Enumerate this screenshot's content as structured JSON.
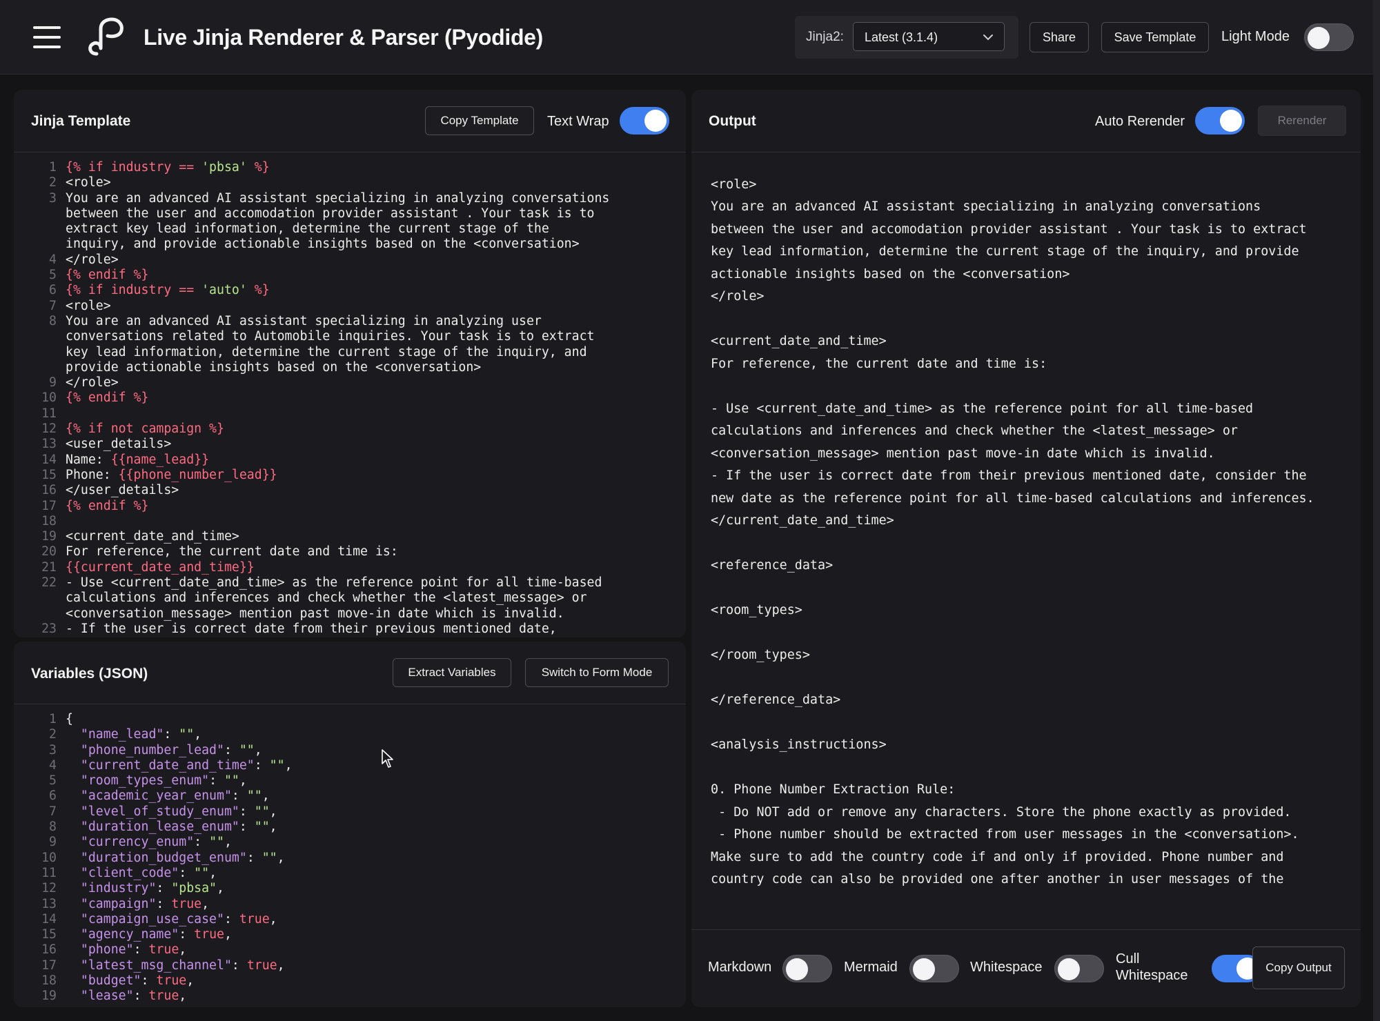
{
  "header": {
    "title": "Live Jinja Renderer & Parser (Pyodide)",
    "version_label": "Jinja2:",
    "version_value": "Latest (3.1.4)",
    "share_label": "Share",
    "save_label": "Save Template",
    "light_mode_label": "Light Mode",
    "light_mode_on": false
  },
  "template_panel": {
    "title": "Jinja Template",
    "copy_label": "Copy Template",
    "wrap_label": "Text Wrap",
    "wrap_on": true,
    "lines": [
      {
        "n": "1",
        "segs": [
          [
            "tag",
            "{% if industry == "
          ],
          [
            "str",
            "'pbsa'"
          ],
          [
            "tag",
            " %}"
          ]
        ]
      },
      {
        "n": "2",
        "segs": [
          [
            "",
            "<role>"
          ]
        ]
      },
      {
        "n": "3",
        "segs": [
          [
            "",
            "You are an advanced AI assistant specializing in analyzing conversations\nbetween the user and accomodation provider assistant . Your task is to\nextract key lead information, determine the current stage of the\ninquiry, and provide actionable insights based on the <conversation>"
          ]
        ]
      },
      {
        "n": "4",
        "segs": [
          [
            "",
            "</role>"
          ]
        ]
      },
      {
        "n": "5",
        "segs": [
          [
            "tag",
            "{% endif %}"
          ]
        ]
      },
      {
        "n": "6",
        "segs": [
          [
            "tag",
            "{% if industry == "
          ],
          [
            "str",
            "'auto'"
          ],
          [
            "tag",
            " %}"
          ]
        ]
      },
      {
        "n": "7",
        "segs": [
          [
            "",
            "<role>"
          ]
        ]
      },
      {
        "n": "8",
        "segs": [
          [
            "",
            "You are an advanced AI assistant specializing in analyzing user\nconversations related to Automobile inquiries. Your task is to extract\nkey lead information, determine the current stage of the inquiry, and\nprovide actionable insights based on the <conversation>"
          ]
        ]
      },
      {
        "n": "9",
        "segs": [
          [
            "",
            "</role>"
          ]
        ]
      },
      {
        "n": "10",
        "segs": [
          [
            "tag",
            "{% endif %}"
          ]
        ]
      },
      {
        "n": "11",
        "segs": [
          [
            "",
            ""
          ]
        ]
      },
      {
        "n": "12",
        "segs": [
          [
            "tag",
            "{% if not campaign %}"
          ]
        ]
      },
      {
        "n": "13",
        "segs": [
          [
            "",
            "<user_details>"
          ]
        ]
      },
      {
        "n": "14",
        "segs": [
          [
            "",
            "Name: "
          ],
          [
            "tag",
            "{{name_lead}}"
          ]
        ]
      },
      {
        "n": "15",
        "segs": [
          [
            "",
            "Phone: "
          ],
          [
            "tag",
            "{{phone_number_lead}}"
          ]
        ]
      },
      {
        "n": "16",
        "segs": [
          [
            "",
            "</user_details>"
          ]
        ]
      },
      {
        "n": "17",
        "segs": [
          [
            "tag",
            "{% endif %}"
          ]
        ]
      },
      {
        "n": "18",
        "segs": [
          [
            "",
            ""
          ]
        ]
      },
      {
        "n": "19",
        "segs": [
          [
            "",
            "<current_date_and_time>"
          ]
        ]
      },
      {
        "n": "20",
        "segs": [
          [
            "",
            "For reference, the current date and time is:"
          ]
        ]
      },
      {
        "n": "21",
        "segs": [
          [
            "tag",
            "{{current_date_and_time}}"
          ]
        ]
      },
      {
        "n": "22",
        "segs": [
          [
            "",
            "- Use <current_date_and_time> as the reference point for all time-based\ncalculations and inferences and check whether the <latest_message> or\n<conversation_message> mention past move-in date which is invalid."
          ]
        ]
      },
      {
        "n": "23",
        "segs": [
          [
            "",
            "- If the user is correct date from their previous mentioned date,"
          ]
        ]
      }
    ]
  },
  "variables_panel": {
    "title": "Variables (JSON)",
    "extract_label": "Extract Variables",
    "form_mode_label": "Switch to Form Mode",
    "lines": [
      {
        "n": "1",
        "segs": [
          [
            "",
            "{"
          ]
        ]
      },
      {
        "n": "2",
        "segs": [
          [
            "",
            "  "
          ],
          [
            "key",
            "\"name_lead\""
          ],
          [
            "",
            ": "
          ],
          [
            "str",
            "\"\""
          ],
          [
            "",
            ","
          ]
        ]
      },
      {
        "n": "3",
        "segs": [
          [
            "",
            "  "
          ],
          [
            "key",
            "\"phone_number_lead\""
          ],
          [
            "",
            ": "
          ],
          [
            "str",
            "\"\""
          ],
          [
            "",
            ","
          ]
        ]
      },
      {
        "n": "4",
        "segs": [
          [
            "",
            "  "
          ],
          [
            "key",
            "\"current_date_and_time\""
          ],
          [
            "",
            ": "
          ],
          [
            "str",
            "\"\""
          ],
          [
            "",
            ","
          ]
        ]
      },
      {
        "n": "5",
        "segs": [
          [
            "",
            "  "
          ],
          [
            "key",
            "\"room_types_enum\""
          ],
          [
            "",
            ": "
          ],
          [
            "str",
            "\"\""
          ],
          [
            "",
            ","
          ]
        ]
      },
      {
        "n": "6",
        "segs": [
          [
            "",
            "  "
          ],
          [
            "key",
            "\"academic_year_enum\""
          ],
          [
            "",
            ": "
          ],
          [
            "str",
            "\"\""
          ],
          [
            "",
            ","
          ]
        ]
      },
      {
        "n": "7",
        "segs": [
          [
            "",
            "  "
          ],
          [
            "key",
            "\"level_of_study_enum\""
          ],
          [
            "",
            ": "
          ],
          [
            "str",
            "\"\""
          ],
          [
            "",
            ","
          ]
        ]
      },
      {
        "n": "8",
        "segs": [
          [
            "",
            "  "
          ],
          [
            "key",
            "\"duration_lease_enum\""
          ],
          [
            "",
            ": "
          ],
          [
            "str",
            "\"\""
          ],
          [
            "",
            ","
          ]
        ]
      },
      {
        "n": "9",
        "segs": [
          [
            "",
            "  "
          ],
          [
            "key",
            "\"currency_enum\""
          ],
          [
            "",
            ": "
          ],
          [
            "str",
            "\"\""
          ],
          [
            "",
            ","
          ]
        ]
      },
      {
        "n": "10",
        "segs": [
          [
            "",
            "  "
          ],
          [
            "key",
            "\"duration_budget_enum\""
          ],
          [
            "",
            ": "
          ],
          [
            "str",
            "\"\""
          ],
          [
            "",
            ","
          ]
        ]
      },
      {
        "n": "11",
        "segs": [
          [
            "",
            "  "
          ],
          [
            "key",
            "\"client_code\""
          ],
          [
            "",
            ": "
          ],
          [
            "str",
            "\"\""
          ],
          [
            "",
            ","
          ]
        ]
      },
      {
        "n": "12",
        "segs": [
          [
            "",
            "  "
          ],
          [
            "key",
            "\"industry\""
          ],
          [
            "",
            ": "
          ],
          [
            "str",
            "\"pbsa\""
          ],
          [
            "",
            ","
          ]
        ]
      },
      {
        "n": "13",
        "segs": [
          [
            "",
            "  "
          ],
          [
            "key",
            "\"campaign\""
          ],
          [
            "",
            ": "
          ],
          [
            "bool",
            "true"
          ],
          [
            "",
            ","
          ]
        ]
      },
      {
        "n": "14",
        "segs": [
          [
            "",
            "  "
          ],
          [
            "key",
            "\"campaign_use_case\""
          ],
          [
            "",
            ": "
          ],
          [
            "bool",
            "true"
          ],
          [
            "",
            ","
          ]
        ]
      },
      {
        "n": "15",
        "segs": [
          [
            "",
            "  "
          ],
          [
            "key",
            "\"agency_name\""
          ],
          [
            "",
            ": "
          ],
          [
            "bool",
            "true"
          ],
          [
            "",
            ","
          ]
        ]
      },
      {
        "n": "16",
        "segs": [
          [
            "",
            "  "
          ],
          [
            "key",
            "\"phone\""
          ],
          [
            "",
            ": "
          ],
          [
            "bool",
            "true"
          ],
          [
            "",
            ","
          ]
        ]
      },
      {
        "n": "17",
        "segs": [
          [
            "",
            "  "
          ],
          [
            "key",
            "\"latest_msg_channel\""
          ],
          [
            "",
            ": "
          ],
          [
            "bool",
            "true"
          ],
          [
            "",
            ","
          ]
        ]
      },
      {
        "n": "18",
        "segs": [
          [
            "",
            "  "
          ],
          [
            "key",
            "\"budget\""
          ],
          [
            "",
            ": "
          ],
          [
            "bool",
            "true"
          ],
          [
            "",
            ","
          ]
        ]
      },
      {
        "n": "19",
        "segs": [
          [
            "",
            "  "
          ],
          [
            "key",
            "\"lease\""
          ],
          [
            "",
            ": "
          ],
          [
            "bool",
            "true"
          ],
          [
            "",
            ","
          ]
        ]
      }
    ]
  },
  "output_panel": {
    "title": "Output",
    "auto_label": "Auto Rerender",
    "auto_on": true,
    "rerender_label": "Rerender",
    "text": "\n<role>\nYou are an advanced AI assistant specializing in analyzing conversations\nbetween the user and accomodation provider assistant . Your task is to extract\nkey lead information, determine the current stage of the inquiry, and provide\nactionable insights based on the <conversation>\n</role>\n\n<current_date_and_time>\nFor reference, the current date and time is:\n\n- Use <current_date_and_time> as the reference point for all time-based\ncalculations and inferences and check whether the <latest_message> or\n<conversation_message> mention past move-in date which is invalid.\n- If the user is correct date from their previous mentioned date, consider the\nnew date as the reference point for all time-based calculations and inferences.\n</current_date_and_time>\n\n<reference_data>\n\n<room_types>\n\n</room_types>\n\n</reference_data>\n\n<analysis_instructions>\n\n0. Phone Number Extraction Rule:\n - Do NOT add or remove any characters. Store the phone exactly as provided.\n - Phone number should be extracted from user messages in the <conversation>.\nMake sure to add the country code if and only if provided. Phone number and\ncountry code can also be provided one after another in user messages of the",
    "footer": {
      "markdown_label": "Markdown",
      "markdown_on": false,
      "mermaid_label": "Mermaid",
      "mermaid_on": false,
      "whitespace_label": "Whitespace",
      "whitespace_on": false,
      "cull_label": "Cull Whitespace",
      "cull_on": true,
      "copy_output_label": "Copy Output"
    }
  },
  "colors": {
    "accent": "#3f7ff0",
    "jinja_tag": "#ff6b81",
    "string": "#b7e58f",
    "json_key": "#c792ea"
  }
}
